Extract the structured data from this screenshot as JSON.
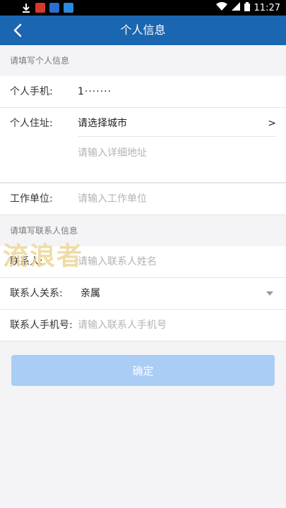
{
  "status_bar": {
    "time": "11:27",
    "icons": [
      "download-icon",
      "app-red-icon",
      "app-blue-icon",
      "app-blue2-icon",
      "wifi-icon",
      "signal-icon",
      "battery-icon"
    ]
  },
  "nav": {
    "title": "个人信息",
    "back_icon": "back-arrow-icon"
  },
  "personal_section": {
    "header": "请填写个人信息",
    "phone": {
      "label": "个人手机:",
      "value": "1·······"
    },
    "address": {
      "label": "个人住址:",
      "city_value": "请选择城市",
      "city_chevron": ">",
      "detail_placeholder": "请输入详细地址"
    },
    "work": {
      "label": "工作单位:",
      "placeholder": "请输入工作单位"
    }
  },
  "contact_section": {
    "header": "请填写联系人信息",
    "contact_name": {
      "label": "联系人:",
      "placeholder": "请输入联系人姓名"
    },
    "relation": {
      "label": "联系人关系:",
      "value": "亲属"
    },
    "contact_phone": {
      "label": "联系人手机号:",
      "placeholder": "请输入联系人手机号"
    }
  },
  "watermark": "流浪者",
  "confirm_label": "确定",
  "colors": {
    "nav": "#1b66b1",
    "button": "#a9cdf5"
  }
}
